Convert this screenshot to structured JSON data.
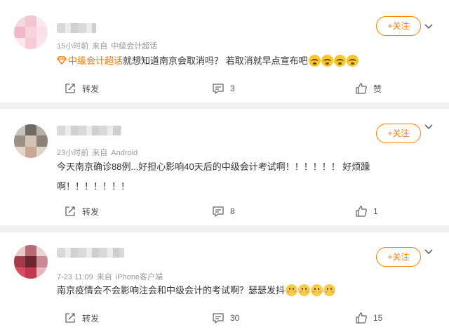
{
  "posts": [
    {
      "time": "15小时前",
      "source_prefix": "来自",
      "source": "中级会计超话",
      "topic": "中级会计超话",
      "text": "就想知道南京会取消吗？ 若取消就早点宣布吧",
      "emojis": [
        "cry-emoji",
        "cry-emoji",
        "cry-emoji",
        "cry-emoji"
      ],
      "follow_label": "+关注",
      "repost_label": "转发",
      "comment_count": "3",
      "like_label": "赞"
    },
    {
      "time": "23小时前",
      "source_prefix": "来自",
      "source": "Android",
      "text_line1": "今天南京确诊88例...好担心影响40天后的中级会计考试啊！！！！！！ 好烦躁",
      "text_line2": "啊！！！！！！！",
      "follow_label": "+关注",
      "repost_label": "转发",
      "comment_count": "8",
      "like_count": "1"
    },
    {
      "time": "7-23 11:09",
      "source_prefix": "来自",
      "source": "iPhone客户端",
      "text": "南京疫情会不会影响注会和中级会计的考试啊？瑟瑟发抖",
      "emojis": [
        "shy-emoji",
        "shy-emoji",
        "shy-emoji",
        "shy-emoji"
      ],
      "follow_label": "+关注",
      "repost_label": "转发",
      "comment_count": "30",
      "like_count": "15"
    }
  ]
}
